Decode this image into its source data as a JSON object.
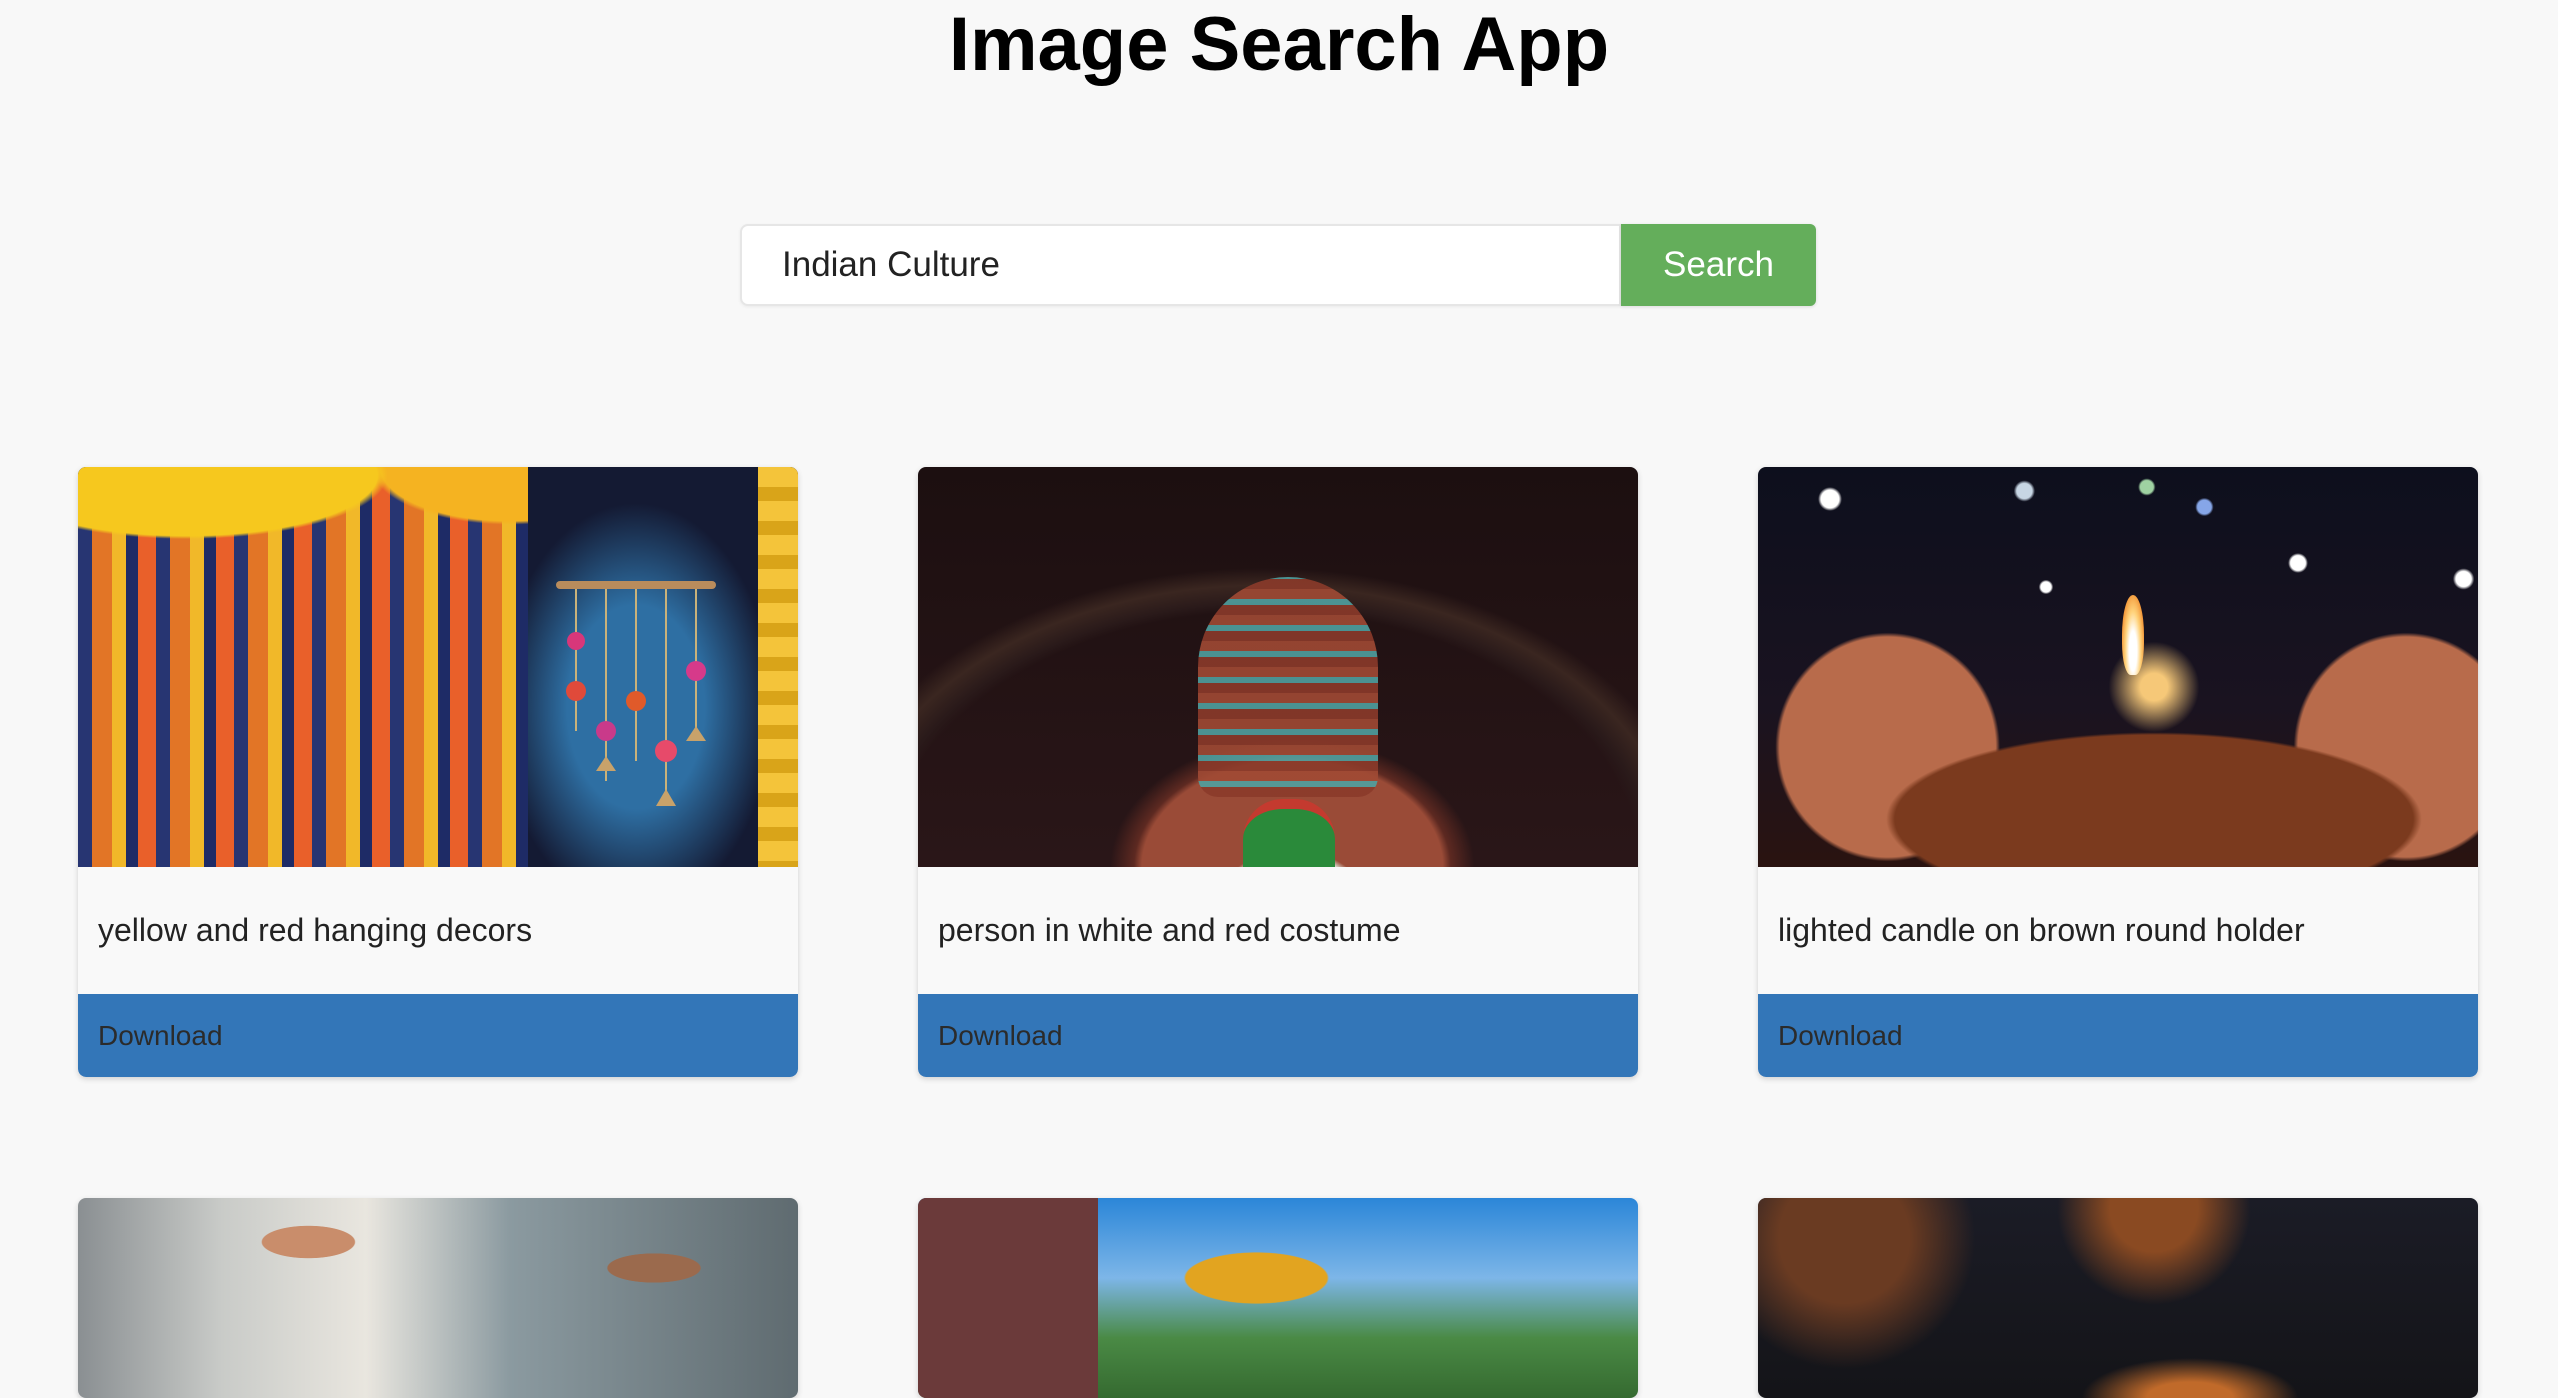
{
  "app": {
    "title": "Image Search App"
  },
  "search": {
    "value": "Indian Culture",
    "button_label": "Search"
  },
  "results": [
    {
      "caption": "yellow and red hanging decors",
      "download_label": "Download"
    },
    {
      "caption": "person in white and red costume",
      "download_label": "Download"
    },
    {
      "caption": "lighted candle on brown round holder",
      "download_label": "Download"
    },
    {
      "caption": "",
      "download_label": ""
    },
    {
      "caption": "",
      "download_label": ""
    },
    {
      "caption": "",
      "download_label": ""
    }
  ],
  "colors": {
    "search_button": "#64ae5b",
    "download_bar": "#3376b8",
    "background": "#f8f8f8"
  }
}
